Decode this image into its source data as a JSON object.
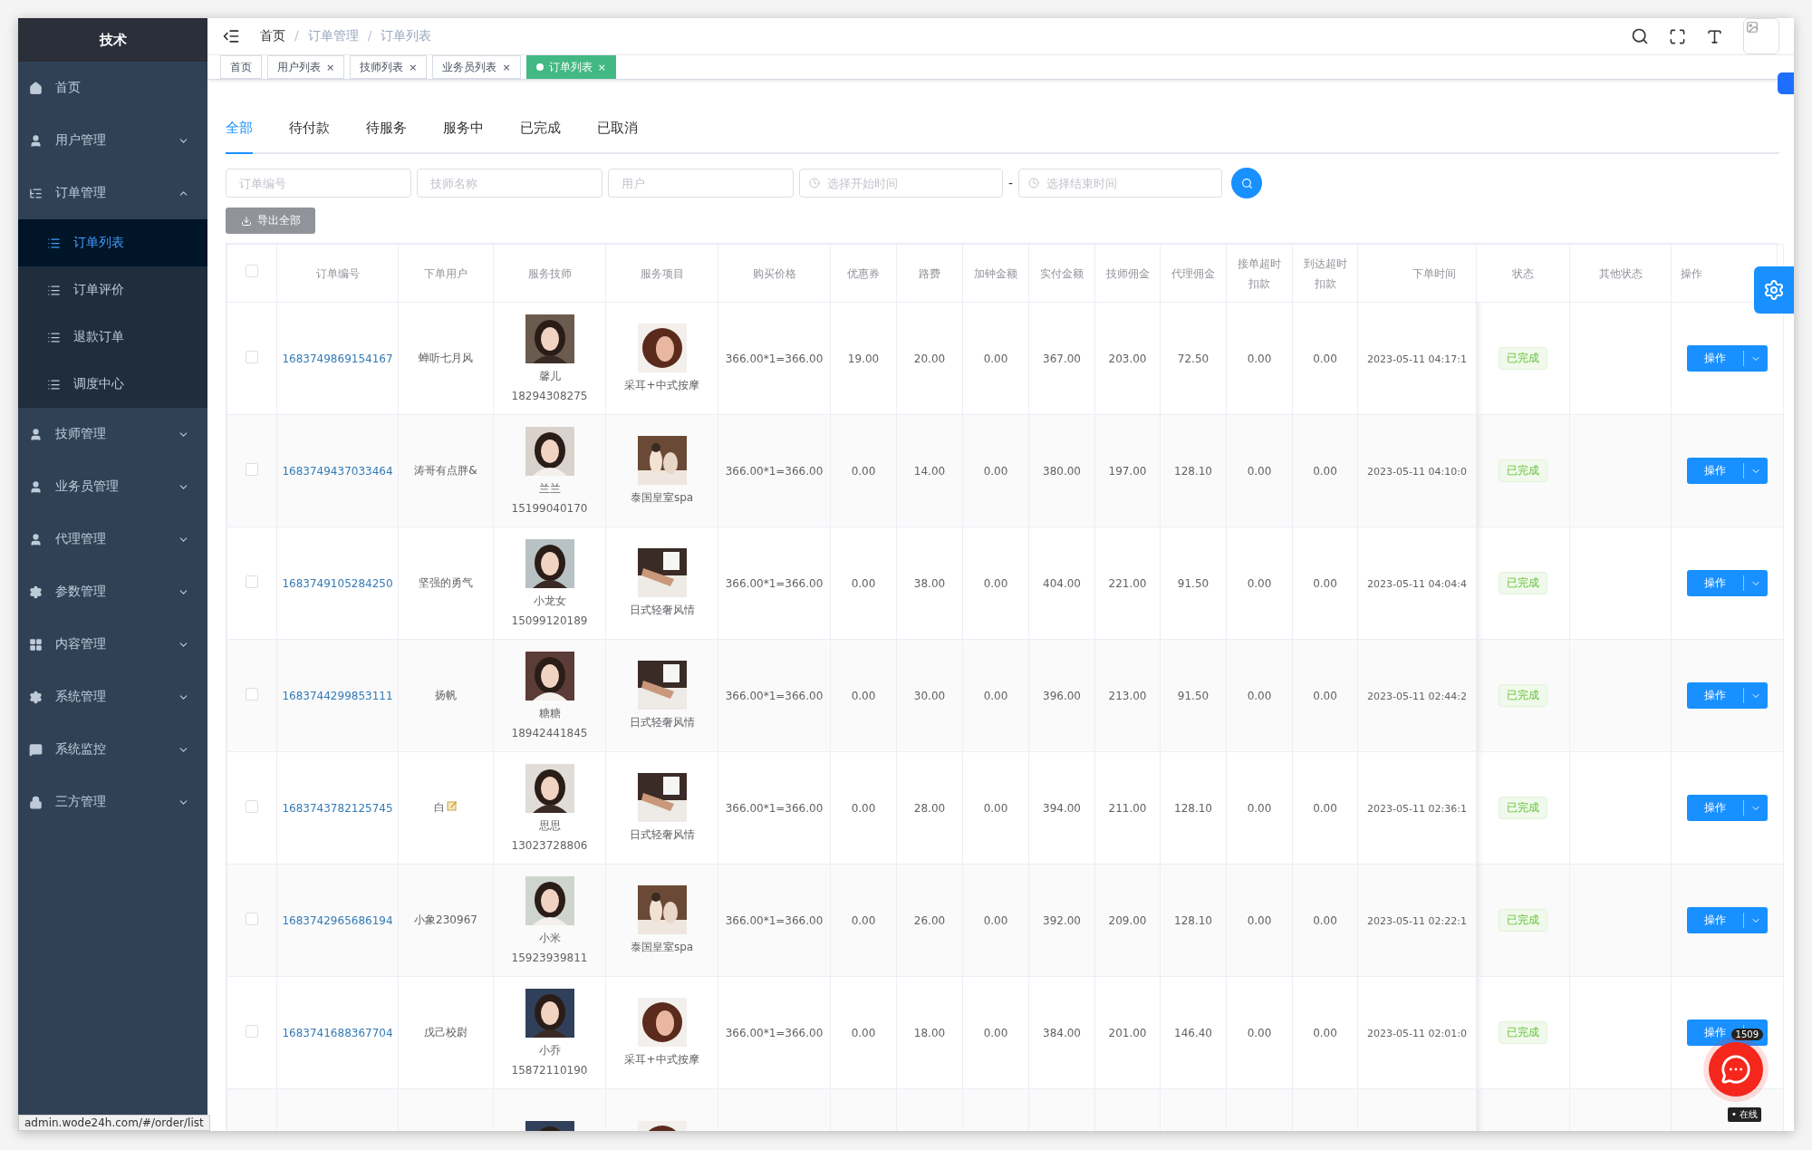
{
  "sidebar": {
    "title": "技术",
    "items": [
      {
        "label": "首页"
      },
      {
        "label": "用户管理",
        "expanded": false
      },
      {
        "label": "订单管理",
        "expanded": true,
        "children": [
          {
            "label": "订单列表",
            "selected": true
          },
          {
            "label": "订单评价",
            "selected": false
          },
          {
            "label": "退款订单",
            "selected": false
          },
          {
            "label": "调度中心",
            "selected": false
          }
        ]
      },
      {
        "label": "技师管理",
        "expanded": false
      },
      {
        "label": "业务员管理",
        "expanded": false
      },
      {
        "label": "代理管理",
        "expanded": false
      },
      {
        "label": "参数管理",
        "expanded": false
      },
      {
        "label": "内容管理",
        "expanded": false
      },
      {
        "label": "系统管理",
        "expanded": false
      },
      {
        "label": "系统监控",
        "expanded": false
      },
      {
        "label": "三方管理",
        "expanded": false
      }
    ]
  },
  "breadcrumb": [
    {
      "label": "首页"
    },
    {
      "separator": "/",
      "label": "订单管理"
    },
    {
      "separator": "/",
      "label": "订单列表"
    }
  ],
  "page_tags": [
    {
      "label": "首页",
      "closable": false,
      "selected": false
    },
    {
      "label": "用户列表",
      "closable": true,
      "selected": false
    },
    {
      "label": "技师列表",
      "closable": true,
      "selected": false
    },
    {
      "label": "业务员列表",
      "closable": true,
      "selected": false
    },
    {
      "label": "订单列表",
      "closable": true,
      "selected": true
    }
  ],
  "close_mark": "×",
  "status_tabs": [
    {
      "label": "全部",
      "selected": true
    },
    {
      "label": "待付款",
      "selected": false
    },
    {
      "label": "待服务",
      "selected": false
    },
    {
      "label": "服务中",
      "selected": false
    },
    {
      "label": "已完成",
      "selected": false
    },
    {
      "label": "已取消",
      "selected": false
    }
  ],
  "filters": {
    "order_no": {
      "placeholder": "订单编号"
    },
    "tech": {
      "placeholder": "技师名称"
    },
    "user": {
      "placeholder": "用户"
    },
    "start": {
      "placeholder": "选择开始时间"
    },
    "separator": "-",
    "end": {
      "placeholder": "选择结束时间"
    }
  },
  "export_button": "导出全部",
  "table": {
    "columns": [
      "订单编号",
      "下单用户",
      "服务技师",
      "服务项目",
      "购买价格",
      "优惠券",
      "路费",
      "加钟金额",
      "实付金额",
      "技师佣金",
      "代理佣金",
      "接单超时扣款",
      "到达超时扣款",
      "下单时间",
      "状态",
      "其他状态",
      "操作"
    ],
    "all_checked": false,
    "rows": [
      {
        "checked": false,
        "order_no": "1683749869154167",
        "user": "蝉听七月风",
        "note_icon": false,
        "tech_name": "馨儿",
        "tech_phone": "18294308275",
        "service": "采耳+中式按摩",
        "price": "366.00*1=366.00",
        "coupon": "19.00",
        "fare": "20.00",
        "extra": "0.00",
        "paid": "367.00",
        "tech_commission": "203.00",
        "agent_commission": "72.50",
        "accept_penalty": "0.00",
        "arrive_penalty": "0.00",
        "time": "2023-05-11 04:17:1",
        "status": "已完成",
        "action": "操作"
      },
      {
        "checked": false,
        "order_no": "1683749437033464",
        "user": "涛哥有点胖&",
        "note_icon": false,
        "tech_name": "兰兰",
        "tech_phone": "15199040170",
        "service": "泰国皇室spa",
        "price": "366.00*1=366.00",
        "coupon": "0.00",
        "fare": "14.00",
        "extra": "0.00",
        "paid": "380.00",
        "tech_commission": "197.00",
        "agent_commission": "128.10",
        "accept_penalty": "0.00",
        "arrive_penalty": "0.00",
        "time": "2023-05-11 04:10:0",
        "status": "已完成",
        "action": "操作"
      },
      {
        "checked": false,
        "order_no": "1683749105284250",
        "user": "坚强的勇气",
        "note_icon": false,
        "tech_name": "小龙女",
        "tech_phone": "15099120189",
        "service": "日式轻奢风情",
        "price": "366.00*1=366.00",
        "coupon": "0.00",
        "fare": "38.00",
        "extra": "0.00",
        "paid": "404.00",
        "tech_commission": "221.00",
        "agent_commission": "91.50",
        "accept_penalty": "0.00",
        "arrive_penalty": "0.00",
        "time": "2023-05-11 04:04:4",
        "status": "已完成",
        "action": "操作"
      },
      {
        "checked": false,
        "order_no": "1683744299853111",
        "user": "扬帆",
        "note_icon": false,
        "tech_name": "糖糖",
        "tech_phone": "18942441845",
        "service": "日式轻奢风情",
        "price": "366.00*1=366.00",
        "coupon": "0.00",
        "fare": "30.00",
        "extra": "0.00",
        "paid": "396.00",
        "tech_commission": "213.00",
        "agent_commission": "91.50",
        "accept_penalty": "0.00",
        "arrive_penalty": "0.00",
        "time": "2023-05-11 02:44:2",
        "status": "已完成",
        "action": "操作"
      },
      {
        "checked": false,
        "order_no": "1683743782125745",
        "user": "白",
        "note_icon": true,
        "tech_name": "思思",
        "tech_phone": "13023728806",
        "service": "日式轻奢风情",
        "price": "366.00*1=366.00",
        "coupon": "0.00",
        "fare": "28.00",
        "extra": "0.00",
        "paid": "394.00",
        "tech_commission": "211.00",
        "agent_commission": "128.10",
        "accept_penalty": "0.00",
        "arrive_penalty": "0.00",
        "time": "2023-05-11 02:36:1",
        "status": "已完成",
        "action": "操作"
      },
      {
        "checked": false,
        "order_no": "1683742965686194",
        "user": "小象230967",
        "note_icon": false,
        "tech_name": "小米",
        "tech_phone": "15923939811",
        "service": "泰国皇室spa",
        "price": "366.00*1=366.00",
        "coupon": "0.00",
        "fare": "26.00",
        "extra": "0.00",
        "paid": "392.00",
        "tech_commission": "209.00",
        "agent_commission": "128.10",
        "accept_penalty": "0.00",
        "arrive_penalty": "0.00",
        "time": "2023-05-11 02:22:1",
        "status": "已完成",
        "action": "操作"
      },
      {
        "checked": false,
        "order_no": "1683741688367704",
        "user": "戊己校尉",
        "note_icon": false,
        "tech_name": "小乔",
        "tech_phone": "15872110190",
        "service": "采耳+中式按摩",
        "price": "366.00*1=366.00",
        "coupon": "0.00",
        "fare": "18.00",
        "extra": "0.00",
        "paid": "384.00",
        "tech_commission": "201.00",
        "agent_commission": "146.40",
        "accept_penalty": "0.00",
        "arrive_penalty": "0.00",
        "time": "2023-05-11 02:01:0",
        "status": "已完成",
        "action": "操作"
      }
    ]
  },
  "chat_widget": {
    "badge": "1509",
    "status": "• 在线"
  },
  "status_url": "admin.wode24h.com/#/order/list"
}
